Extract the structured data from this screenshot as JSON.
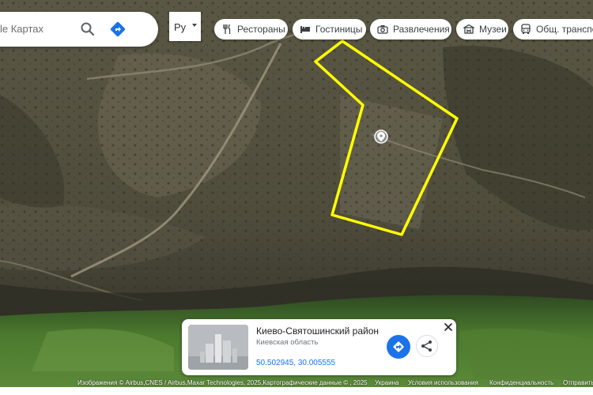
{
  "search": {
    "text": "le Картах"
  },
  "language": {
    "label": "Ру"
  },
  "chips": [
    {
      "label": "Рестораны",
      "icon": "restaurant-icon"
    },
    {
      "label": "Гостиницы",
      "icon": "hotel-icon"
    },
    {
      "label": "Развлечения",
      "icon": "camera-icon"
    },
    {
      "label": "Музеи",
      "icon": "museum-icon"
    },
    {
      "label": "Общ. транспорт",
      "icon": "bus-icon"
    }
  ],
  "place_card": {
    "title": "Киево-Святошинский район",
    "subtitle": "Киевская область",
    "coords": "50.502945, 30.005555"
  },
  "attribution": {
    "imagery": "Изображения © Airbus,CNES / Airbus,Maxar Technologies, 2025,Картографические данные © , 2025",
    "country": "Украина",
    "terms": "Условия использования",
    "privacy": "Конфиденциальность",
    "feedback": "Отправить"
  },
  "colors": {
    "boundary": "#ffff00",
    "accent": "#1a73e8"
  }
}
